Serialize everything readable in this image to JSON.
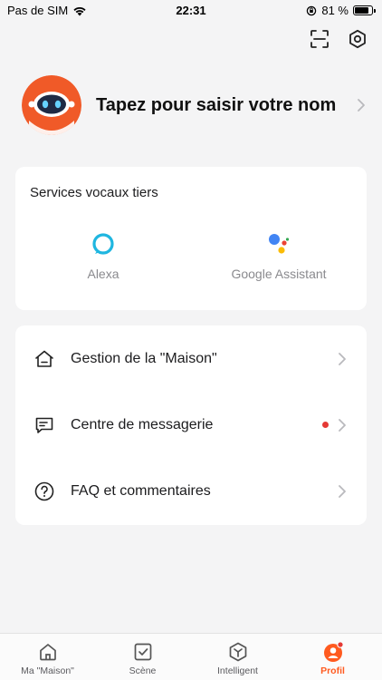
{
  "status_bar": {
    "carrier": "Pas de SIM",
    "time": "22:31",
    "battery_percent_label": "81 %",
    "battery_level": 0.81
  },
  "header": {
    "scan_icon": "scan-icon",
    "settings_icon": "hexagon-settings-icon"
  },
  "profile": {
    "name_placeholder": "Tapez pour saisir votre nom",
    "avatar_icon": "robot-avatar-icon"
  },
  "voice_services": {
    "title": "Services vocaux tiers",
    "items": [
      {
        "label": "Alexa",
        "icon": "alexa-icon"
      },
      {
        "label": "Google Assistant",
        "icon": "google-assistant-icon"
      }
    ]
  },
  "menu": {
    "items": [
      {
        "label": "Gestion de la \"Maison\"",
        "icon": "home-outline-icon",
        "has_badge": false
      },
      {
        "label": "Centre de messagerie",
        "icon": "message-icon",
        "has_badge": true
      },
      {
        "label": "FAQ et commentaires",
        "icon": "help-circle-icon",
        "has_badge": false
      }
    ]
  },
  "tabs": [
    {
      "label": "Ma \"Maison\"",
      "icon": "home-tab-icon",
      "active": false
    },
    {
      "label": "Scène",
      "icon": "scene-check-icon",
      "active": false
    },
    {
      "label": "Intelligent",
      "icon": "intelligent-hex-icon",
      "active": false
    },
    {
      "label": "Profil",
      "icon": "profile-tab-icon",
      "active": true
    }
  ],
  "colors": {
    "accent": "#ff5a1f",
    "badge_red": "#e53935",
    "alexa_blue": "#1fb6e0",
    "background": "#f4f4f5"
  }
}
